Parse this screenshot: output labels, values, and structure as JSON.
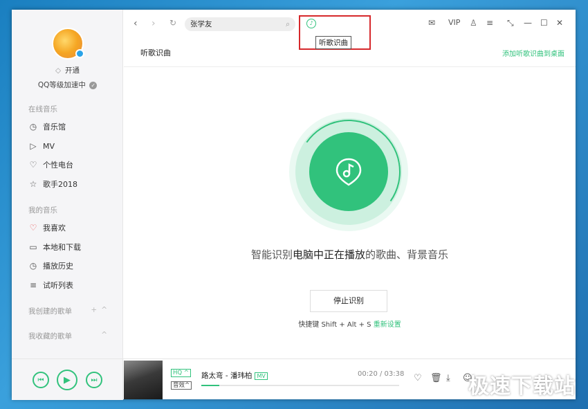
{
  "sidebar": {
    "vip_label": "开通",
    "level_label": "QQ等级加速中",
    "online_title": "在线音乐",
    "online_items": [
      {
        "label": "音乐馆",
        "icon": "music-hall-icon",
        "glyph": "◷"
      },
      {
        "label": "MV",
        "icon": "mv-icon",
        "glyph": "▷"
      },
      {
        "label": "个性电台",
        "icon": "radio-icon",
        "glyph": "♡"
      },
      {
        "label": "歌手2018",
        "icon": "star-icon",
        "glyph": "☆"
      }
    ],
    "my_title": "我的音乐",
    "my_items": [
      {
        "label": "我喜欢",
        "icon": "heart-icon",
        "glyph": "♡"
      },
      {
        "label": "本地和下载",
        "icon": "computer-icon",
        "glyph": "▭"
      },
      {
        "label": "播放历史",
        "icon": "clock-icon",
        "glyph": "◷"
      },
      {
        "label": "试听列表",
        "icon": "list-icon",
        "glyph": "≡"
      }
    ],
    "created_label": "我创建的歌单",
    "collected_label": "我收藏的歌单"
  },
  "topbar": {
    "search_value": "张学友",
    "tooltip": "听歌识曲",
    "vip": "VIP"
  },
  "content": {
    "page_title": "听歌识曲",
    "add_desktop": "添加听歌识曲到桌面",
    "desc_pre": "智能识别",
    "desc_bold": "电脑中正在播放",
    "desc_post": "的歌曲、背景音乐",
    "stop_label": "停止识别",
    "shortcut": "快捷键 Shift + Alt + S",
    "reset": "重新设置"
  },
  "player": {
    "quality": "HQ",
    "effect": "音效",
    "song": "路太弯 - 潘玮柏",
    "mv": "MV",
    "time": "00:20 / 03:38",
    "progress_fraction": 0.092
  },
  "watermark": "极速下载站",
  "colors": {
    "accent": "#31c27c",
    "highlight": "#d6282b"
  }
}
